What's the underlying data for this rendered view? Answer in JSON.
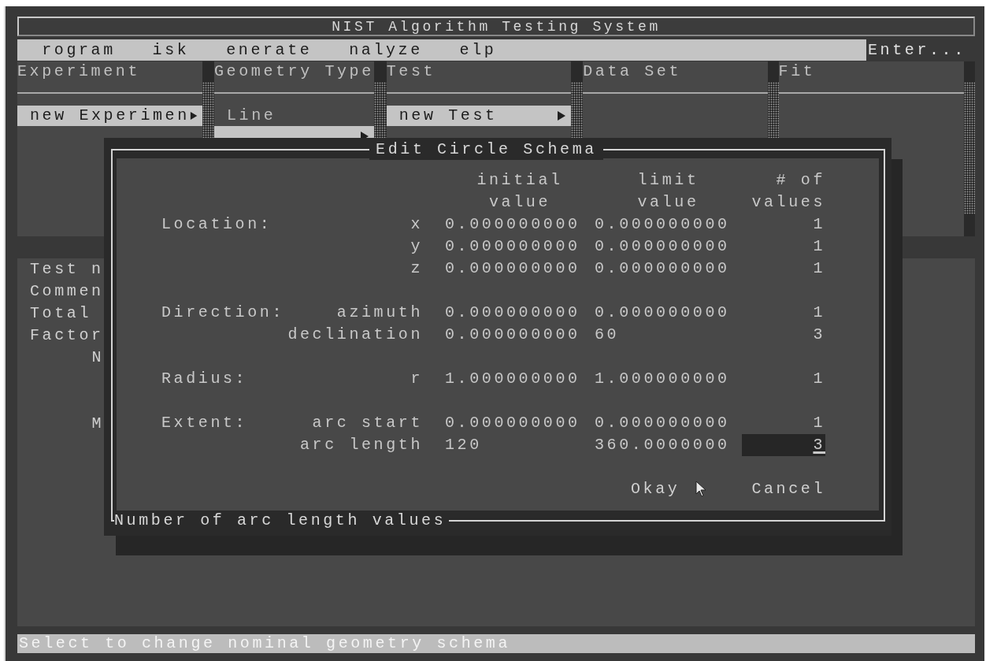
{
  "window": {
    "title": "NIST Algorithm Testing System"
  },
  "menu": {
    "items": [
      {
        "label": "rogram"
      },
      {
        "label": "isk"
      },
      {
        "label": "enerate"
      },
      {
        "label": "nalyze"
      },
      {
        "label": "elp"
      }
    ],
    "hint": "Enter..."
  },
  "columns": [
    {
      "title": "Experiment",
      "items": [
        {
          "label": "new Experimen",
          "submenu": true,
          "selected": true
        }
      ]
    },
    {
      "title": "Geometry Type",
      "items": [
        {
          "label": "Line",
          "submenu": false,
          "selected": false
        },
        {
          "submenu": true,
          "selected": true
        }
      ]
    },
    {
      "title": "Test",
      "items": [
        {
          "label": "new Test",
          "submenu": true,
          "selected": true
        }
      ]
    },
    {
      "title": "Data Set"
    },
    {
      "title": "Fit"
    }
  ],
  "details": [
    {
      "text": "Test n",
      "kind": "left"
    },
    {
      "text": "Commen",
      "kind": "left"
    },
    {
      "text": "Total",
      "kind": "left"
    },
    {
      "text": "Factor",
      "kind": "left"
    },
    {
      "text": "N",
      "kind": "right"
    },
    {
      "text": "M",
      "kind": "right"
    }
  ],
  "dialog": {
    "title": "Edit Circle Schema",
    "headers": [
      "initial value",
      "limit value",
      "# of values"
    ],
    "groups": [
      {
        "label": "Location:",
        "rows": [
          {
            "axis": "x",
            "initial": "0.000000000",
            "limit": "0.000000000",
            "count": "1",
            "focused": false
          },
          {
            "axis": "y",
            "initial": "0.000000000",
            "limit": "0.000000000",
            "count": "1",
            "focused": false
          },
          {
            "axis": "z",
            "initial": "0.000000000",
            "limit": "0.000000000",
            "count": "1",
            "focused": false
          }
        ]
      },
      {
        "label": "Direction:",
        "rows": [
          {
            "axis": "azimuth",
            "initial": "0.000000000",
            "limit": "0.000000000",
            "count": "1",
            "focused": false
          },
          {
            "axis": "declination",
            "initial": "0.000000000",
            "limit": "60",
            "count": "3",
            "focused": false
          }
        ]
      },
      {
        "label": "Radius:",
        "rows": [
          {
            "axis": "r",
            "initial": "1.000000000",
            "limit": "1.000000000",
            "count": "1",
            "focused": false
          }
        ]
      },
      {
        "label": "Extent:",
        "rows": [
          {
            "axis": "arc start",
            "initial": "0.000000000",
            "limit": "0.000000000",
            "count": "1",
            "focused": false
          },
          {
            "axis": "arc length",
            "initial": "120",
            "limit": "360.0000000",
            "count": "3",
            "focused": true
          }
        ]
      }
    ],
    "buttons": [
      {
        "label": "Okay"
      },
      {
        "label": "Cancel"
      }
    ],
    "hint": "Number of arc length values"
  },
  "status_bar": "Select to change nominal geometry schema"
}
